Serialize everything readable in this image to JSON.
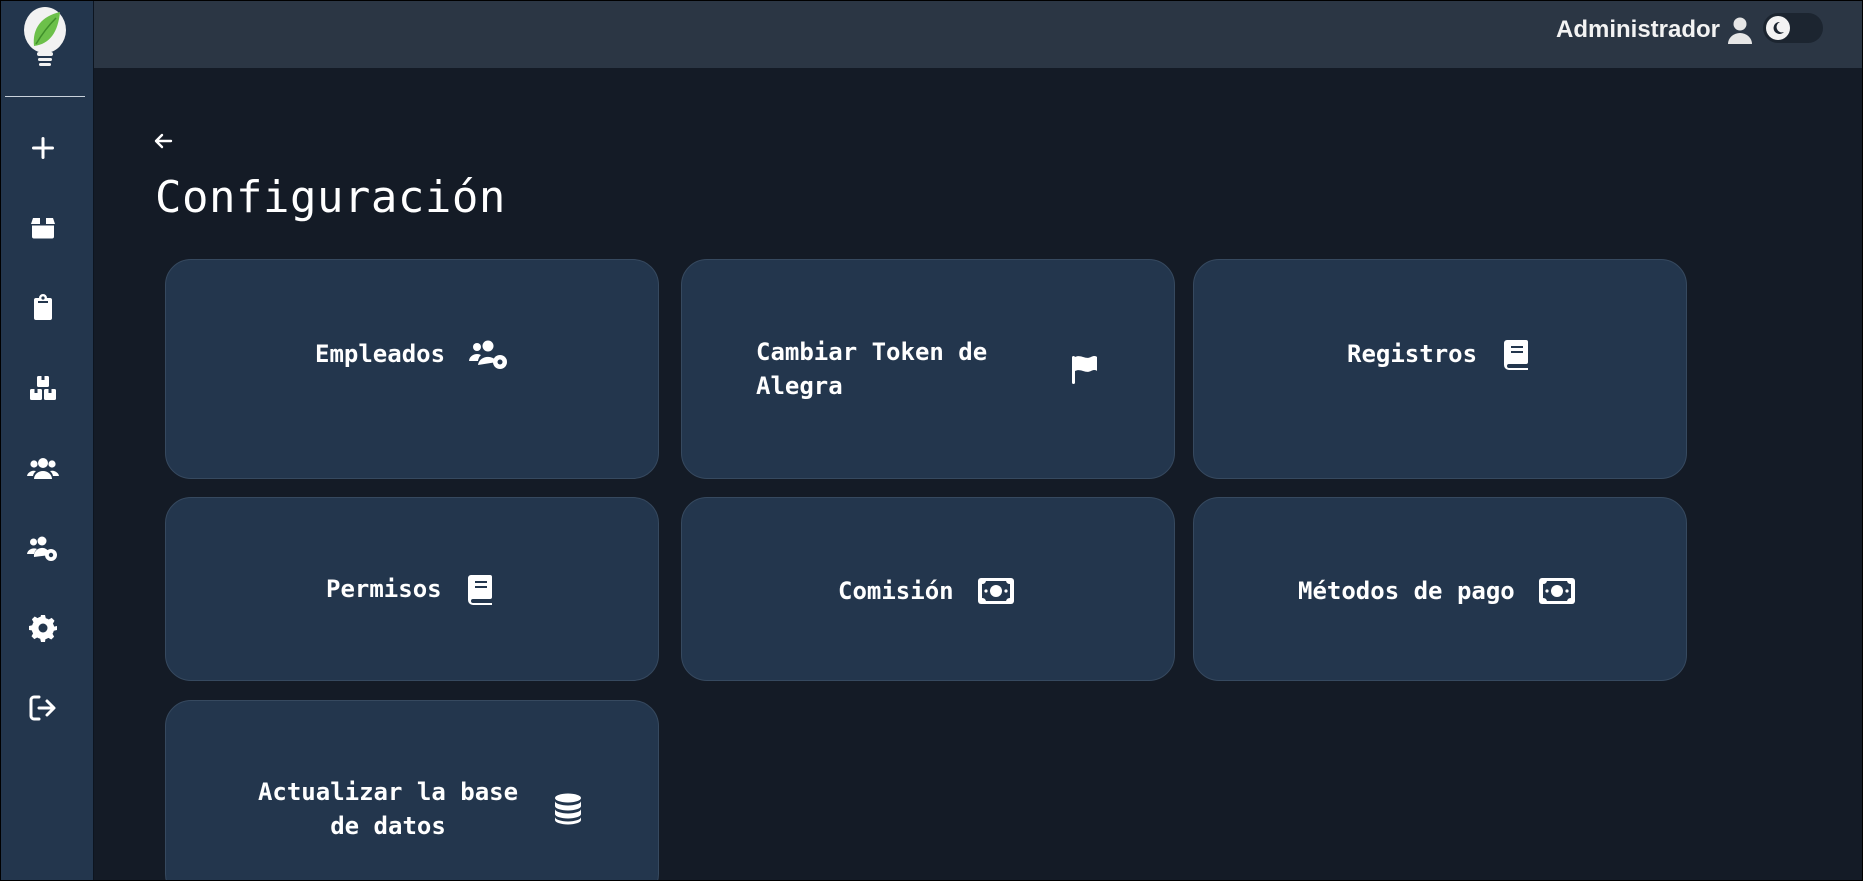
{
  "header": {
    "user_name": "Administrador"
  },
  "sidebar": {
    "items": [
      {
        "icon": "plus-icon",
        "label": "Nuevo"
      },
      {
        "icon": "box-icon",
        "label": "Productos"
      },
      {
        "icon": "clipboard-icon",
        "label": "Pedidos"
      },
      {
        "icon": "boxes-icon",
        "label": "Inventario"
      },
      {
        "icon": "users-icon",
        "label": "Clientes"
      },
      {
        "icon": "users-gear-icon",
        "label": "Empleados"
      },
      {
        "icon": "gear-icon",
        "label": "Configuración"
      },
      {
        "icon": "logout-icon",
        "label": "Salir"
      }
    ]
  },
  "page": {
    "title": "Configuración"
  },
  "cards": [
    {
      "label": "Empleados",
      "icon": "users-gear-icon"
    },
    {
      "label_line1": "Cambiar Token de",
      "label_line2": "Alegra",
      "icon": "flag-icon"
    },
    {
      "label": "Registros",
      "icon": "book-icon"
    },
    {
      "label": "Permisos",
      "icon": "book-icon"
    },
    {
      "label": "Comisión",
      "icon": "money-bill-icon"
    },
    {
      "label": "Métodos de pago",
      "icon": "money-bill-icon"
    },
    {
      "label_line1": "Actualizar la base",
      "label_line2": "de datos",
      "icon": "database-icon"
    }
  ],
  "colors": {
    "background": "#141b26",
    "sidebar": "#23364d",
    "header": "#2b3644",
    "card": "#23364d",
    "logo_green": "#6cc04a"
  }
}
